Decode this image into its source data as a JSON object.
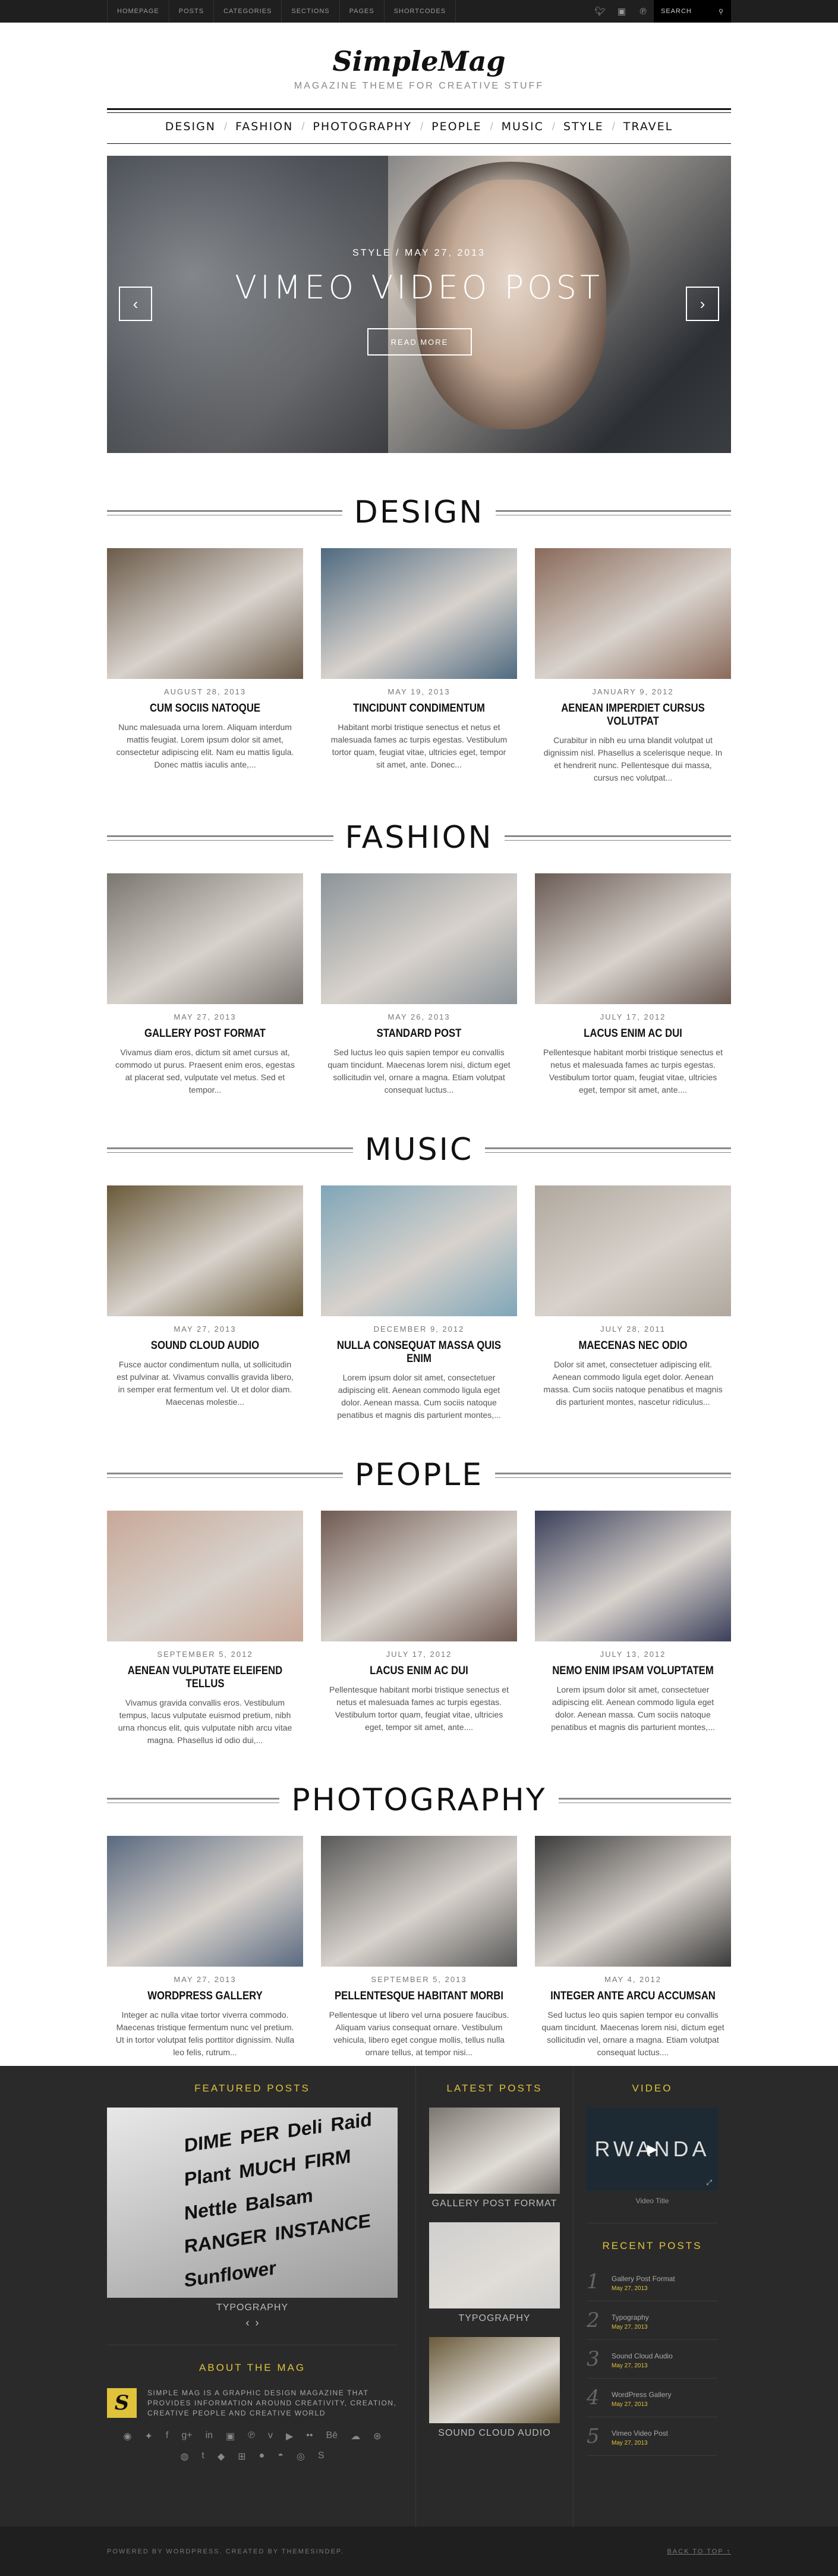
{
  "topbar": {
    "nav": [
      "HOMEPAGE",
      "POSTS",
      "CATEGORIES",
      "SECTIONS",
      "PAGES",
      "SHORTCODES"
    ],
    "search_label": "SEARCH"
  },
  "header": {
    "logo": "SimpleMag",
    "tagline": "MAGAZINE THEME FOR CREATIVE STUFF"
  },
  "mainnav": [
    "DESIGN",
    "FASHION",
    "PHOTOGRAPHY",
    "PEOPLE",
    "MUSIC",
    "STYLE",
    "TRAVEL"
  ],
  "slider": {
    "meta": "STYLE / MAY 27, 2013",
    "title": "VIMEO VIDEO POST",
    "button": "READ MORE",
    "prev": "‹",
    "next": "›"
  },
  "sections": [
    {
      "title": "DESIGN",
      "posts": [
        {
          "date": "AUGUST 28, 2013",
          "title": "CUM SOCIIS NATOQUE",
          "excerpt": "Nunc malesuada urna lorem. Aliquam interdum mattis feugiat. Lorem ipsum dolor sit amet, consectetur adipiscing elit. Nam eu mattis ligula. Donec mattis iaculis ante,...",
          "color": "#6b5b4a"
        },
        {
          "date": "MAY 19, 2013",
          "title": "TINCIDUNT CONDIMENTUM",
          "excerpt": "Habitant morbi tristique senectus et netus et malesuada fames ac turpis egestas. Vestibulum tortor quam, feugiat vitae, ultricies eget, tempor sit amet, ante. Donec...",
          "color": "#4f6a80"
        },
        {
          "date": "JANUARY 9, 2012",
          "title": "AENEAN IMPERDIET CURSUS VOLUTPAT",
          "excerpt": "Curabitur in nibh eu urna blandit volutpat ut dignissim nisl. Phasellus a scelerisque neque. In et hendrerit nunc. Pellentesque dui massa, cursus nec volutpat...",
          "color": "#8a6a5a"
        }
      ]
    },
    {
      "title": "FASHION",
      "posts": [
        {
          "date": "MAY 27, 2013",
          "title": "GALLERY POST FORMAT",
          "excerpt": "Vivamus diam eros, dictum sit amet cursus at, commodo ut purus. Praesent enim eros, egestas at placerat sed, vulputate vel metus. Sed et tempor...",
          "color": "#7c7670"
        },
        {
          "date": "MAY 26, 2013",
          "title": "STANDARD POST",
          "excerpt": "Sed luctus leo quis sapien tempor eu convallis quam tincidunt. Maecenas lorem nisi, dictum eget sollicitudin vel, ornare a magna. Etiam volutpat consequat luctus...",
          "color": "#8c9499"
        },
        {
          "date": "JULY 17, 2012",
          "title": "LACUS ENIM AC DUI",
          "excerpt": "Pellentesque habitant morbi tristique senectus et netus et malesuada fames ac turpis egestas. Vestibulum tortor quam, feugiat vitae, ultricies eget, tempor sit amet, ante....",
          "color": "#6a5a54"
        }
      ]
    },
    {
      "title": "MUSIC",
      "posts": [
        {
          "date": "MAY 27, 2013",
          "title": "SOUND CLOUD AUDIO",
          "excerpt": "Fusce auctor condimentum nulla, ut sollicitudin est pulvinar at. Vivamus convallis gravida libero, in semper erat fermentum vel. Ut et dolor diam. Maecenas molestie...",
          "color": "#6a5a3a"
        },
        {
          "date": "DECEMBER 9, 2012",
          "title": "NULLA CONSEQUAT MASSA QUIS ENIM",
          "excerpt": "Lorem ipsum dolor sit amet, consectetuer adipiscing elit. Aenean commodo ligula eget dolor. Aenean massa. Cum sociis natoque penatibus et magnis dis parturient montes,...",
          "color": "#7fa6b8"
        },
        {
          "date": "JULY 28, 2011",
          "title": "MAECENAS NEC ODIO",
          "excerpt": "Dolor sit amet, consectetuer adipiscing elit. Aenean commodo ligula eget dolor. Aenean massa. Cum sociis natoque penatibus et magnis dis parturient montes, nascetur ridiculus...",
          "color": "#b0a89e"
        }
      ]
    },
    {
      "title": "PEOPLE",
      "posts": [
        {
          "date": "SEPTEMBER 5, 2012",
          "title": "AENEAN VULPUTATE ELEIFEND TELLUS",
          "excerpt": "Vivamus gravida convallis eros. Vestibulum tempus, lacus vulputate euismod pretium, nibh urna rhoncus elit, quis vulputate nibh arcu vitae magna. Phasellus id odio dui,...",
          "color": "#c8a898"
        },
        {
          "date": "JULY 17, 2012",
          "title": "LACUS ENIM AC DUI",
          "excerpt": "Pellentesque habitant morbi tristique senectus et netus et malesuada fames ac turpis egestas. Vestibulum tortor quam, feugiat vitae, ultricies eget, tempor sit amet, ante....",
          "color": "#6f5a52"
        },
        {
          "date": "JULY 13, 2012",
          "title": "NEMO ENIM IPSAM VOLUPTATEM",
          "excerpt": "Lorem ipsum dolor sit amet, consectetuer adipiscing elit. Aenean commodo ligula eget dolor. Aenean massa. Cum sociis natoque penatibus et magnis dis parturient montes,...",
          "color": "#3a3f5a"
        }
      ]
    },
    {
      "title": "PHOTOGRAPHY",
      "posts": [
        {
          "date": "MAY 27, 2013",
          "title": "WORDPRESS GALLERY",
          "excerpt": "Integer ac nulla vitae tortor viverra commodo. Maecenas tristique fermentum nunc vel pretium. Ut in tortor volutpat felis porttitor dignissim. Nulla leo felis, rutrum...",
          "color": "#5a6a80"
        },
        {
          "date": "SEPTEMBER 5, 2013",
          "title": "PELLENTESQUE HABITANT MORBI",
          "excerpt": "Pellentesque ut libero vel urna posuere faucibus. Aliquam varius consequat ornare. Vestibulum vehicula, libero eget congue mollis, tellus nulla ornare tellus, at tempor nisi...",
          "color": "#5a5a5a"
        },
        {
          "date": "MAY 4, 2012",
          "title": "INTEGER ANTE ARCU ACCUMSAN",
          "excerpt": "Sed luctus leo quis sapien tempor eu convallis quam tincidunt. Maecenas lorem nisi, dictum eget sollicitudin vel, ornare a magna. Etiam volutpat consequat luctus....",
          "color": "#3a3a3a"
        }
      ]
    }
  ],
  "footer": {
    "featured_heading": "FEATURED POSTS",
    "featured_caption": "TYPOGRAPHY",
    "featured_image_words": [
      "DIME",
      "PER",
      "Deli",
      "Raid",
      "Plant",
      "MUCH",
      "FIRM",
      "Nettle",
      "Balsam",
      "RANGER",
      "INSTANCE",
      "Sunflower"
    ],
    "about_heading": "ABOUT THE MAG",
    "about_text": "SIMPLE MAG IS A GRAPHIC DESIGN MAGAZINE THAT PROVIDES INFORMATION AROUND CREATIVITY, CREATION, CREATIVE PEOPLE AND CREATIVE WORLD",
    "latest_heading": "LATEST POSTS",
    "latest": [
      {
        "caption": "GALLERY POST FORMAT",
        "color": "#7c7670"
      },
      {
        "caption": "TYPOGRAPHY",
        "color": "#cfcfcf"
      },
      {
        "caption": "SOUND CLOUD AUDIO",
        "color": "#6a5a3a"
      }
    ],
    "video_heading": "VIDEO",
    "video_title": "RWANDA",
    "video_caption": "Video Title",
    "recent_heading": "RECENT POSTS",
    "recent": [
      {
        "n": "1",
        "title": "Gallery Post Format",
        "date": "May 27, 2013"
      },
      {
        "n": "2",
        "title": "Typography",
        "date": "May 27, 2013"
      },
      {
        "n": "3",
        "title": "Sound Cloud Audio",
        "date": "May 27, 2013"
      },
      {
        "n": "4",
        "title": "WordPress Gallery",
        "date": "May 27, 2013"
      },
      {
        "n": "5",
        "title": "Vimeo Video Post",
        "date": "May 27, 2013"
      }
    ]
  },
  "bottombar": {
    "credit": "POWERED BY WORDPRESS. CREATED BY THEMESINDEP.",
    "backtotop": "BACK TO TOP ↑"
  },
  "colors": {
    "accent": "#e0c33a",
    "dark": "#2a2a2a",
    "topbar": "#1f1f1f"
  }
}
